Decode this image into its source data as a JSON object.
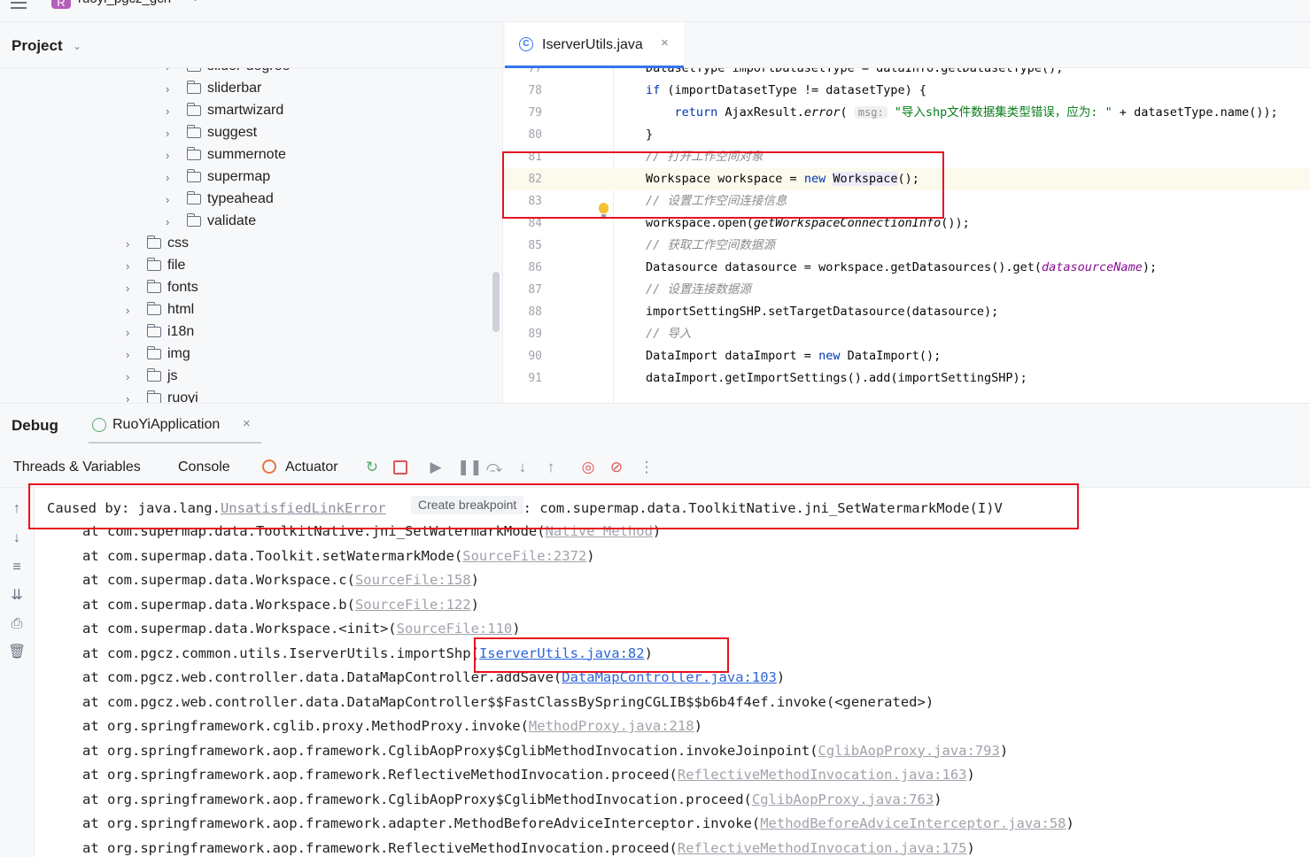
{
  "topbar": {
    "project_badge": "R",
    "project_name": "ruoyi_pgcz_gcn"
  },
  "project_pane": {
    "title": "Project",
    "tree": [
      {
        "label": "slider-degree",
        "indent": 2
      },
      {
        "label": "sliderbar",
        "indent": 2
      },
      {
        "label": "smartwizard",
        "indent": 2
      },
      {
        "label": "suggest",
        "indent": 2
      },
      {
        "label": "summernote",
        "indent": 2
      },
      {
        "label": "supermap",
        "indent": 2
      },
      {
        "label": "typeahead",
        "indent": 2
      },
      {
        "label": "validate",
        "indent": 2
      },
      {
        "label": "css",
        "indent": 1
      },
      {
        "label": "file",
        "indent": 1
      },
      {
        "label": "fonts",
        "indent": 1
      },
      {
        "label": "html",
        "indent": 1
      },
      {
        "label": "i18n",
        "indent": 1
      },
      {
        "label": "img",
        "indent": 1
      },
      {
        "label": "js",
        "indent": 1
      },
      {
        "label": "ruoyi",
        "indent": 1
      }
    ]
  },
  "editor": {
    "tab_title": "IserverUtils.java",
    "tab_icon_letter": "C",
    "current_line": "82",
    "lines": [
      {
        "no": "77",
        "parts": [
          [
            "",
            "DatasetType importDatasetType = dataInfo.getDatasetType();"
          ]
        ]
      },
      {
        "no": "78",
        "parts": [
          [
            "kw",
            "if"
          ],
          [
            "",
            " (importDatasetType != datasetType) {"
          ]
        ]
      },
      {
        "no": "79",
        "parts": [
          [
            "",
            "    "
          ],
          [
            "kw",
            "return"
          ],
          [
            "",
            " AjaxResult."
          ],
          [
            "it",
            "error"
          ],
          [
            "",
            "( "
          ],
          [
            "hint",
            "msg:"
          ],
          [
            "",
            " "
          ],
          [
            "st",
            "\"导入shp文件数据集类型错误，应为: \""
          ],
          [
            "",
            " + datasetType.name());"
          ]
        ]
      },
      {
        "no": "80",
        "parts": [
          [
            "",
            "}"
          ]
        ]
      },
      {
        "no": "81",
        "parts": [
          [
            "cm",
            "// 打开工作空间对象"
          ]
        ]
      },
      {
        "no": "82",
        "parts": [
          [
            "",
            "Workspace workspace = "
          ],
          [
            "kw",
            "new"
          ],
          [
            "",
            " "
          ],
          [
            "hl",
            "Workspace"
          ],
          [
            "",
            "();"
          ]
        ]
      },
      {
        "no": "83",
        "parts": [
          [
            "cm",
            "// 设置工作空间连接信息"
          ]
        ]
      },
      {
        "no": "84",
        "parts": [
          [
            "",
            "workspace.open("
          ],
          [
            "it",
            "getWorkspaceConnectionInfo"
          ],
          [
            "",
            "());"
          ]
        ]
      },
      {
        "no": "85",
        "parts": [
          [
            "cm",
            "// 获取工作空间数据源"
          ]
        ]
      },
      {
        "no": "86",
        "parts": [
          [
            "",
            "Datasource datasource = workspace.getDatasources().get("
          ],
          [
            "fld",
            "datasourceName"
          ],
          [
            "",
            ");"
          ]
        ]
      },
      {
        "no": "87",
        "parts": [
          [
            "cm",
            "// 设置连接数据源"
          ]
        ]
      },
      {
        "no": "88",
        "parts": [
          [
            "",
            "importSettingSHP.setTargetDatasource(datasource);"
          ]
        ]
      },
      {
        "no": "89",
        "parts": [
          [
            "cm",
            "// 导入"
          ]
        ]
      },
      {
        "no": "90",
        "parts": [
          [
            "",
            "DataImport dataImport = "
          ],
          [
            "kw",
            "new"
          ],
          [
            "",
            " DataImport();"
          ]
        ]
      },
      {
        "no": "91",
        "parts": [
          [
            "",
            "dataImport.getImportSettings().add(importSettingSHP);"
          ]
        ]
      }
    ]
  },
  "debug": {
    "title": "Debug",
    "run_config": "RuoYiApplication",
    "tabs": [
      "Threads & Variables",
      "Console",
      "Actuator"
    ]
  },
  "console": {
    "caused_by": {
      "prefix": "Caused by: java.lang.",
      "exception": "UnsatisfiedLinkError",
      "tooltip": "Create breakpoint",
      "suffix": ": com.supermap.data.ToolkitNative.jni_SetWatermarkMode(I)V"
    },
    "frames": [
      {
        "text": "at com.supermap.data.ToolkitNative.jni_SetWatermarkMode(",
        "link": "Native Method",
        "end": ")",
        "active": false
      },
      {
        "text": "at com.supermap.data.Toolkit.setWatermarkMode(",
        "link": "SourceFile:2372",
        "end": ")",
        "active": false
      },
      {
        "text": "at com.supermap.data.Workspace.c(",
        "link": "SourceFile:158",
        "end": ")",
        "active": false
      },
      {
        "text": "at com.supermap.data.Workspace.b(",
        "link": "SourceFile:122",
        "end": ")",
        "active": false
      },
      {
        "text": "at com.supermap.data.Workspace.<init>(",
        "link": "SourceFile:110",
        "end": ")",
        "active": false
      },
      {
        "text": "at com.pgcz.common.utils.IserverUtils.importShp(",
        "link": "IserverUtils.java:82",
        "end": ")",
        "active": true
      },
      {
        "text": "at com.pgcz.web.controller.data.DataMapController.addSave(",
        "link": "DataMapController.java:103",
        "end": ")",
        "active": true
      },
      {
        "text": "at com.pgcz.web.controller.data.DataMapController$$FastClassBySpringCGLIB$$b6b4f4ef.invoke(<generated>)",
        "link": "",
        "end": "",
        "active": false
      },
      {
        "text": "at org.springframework.cglib.proxy.MethodProxy.invoke(",
        "link": "MethodProxy.java:218",
        "end": ")",
        "active": false
      },
      {
        "text": "at org.springframework.aop.framework.CglibAopProxy$CglibMethodInvocation.invokeJoinpoint(",
        "link": "CglibAopProxy.java:793",
        "end": ")",
        "active": false
      },
      {
        "text": "at org.springframework.aop.framework.ReflectiveMethodInvocation.proceed(",
        "link": "ReflectiveMethodInvocation.java:163",
        "end": ")",
        "active": false
      },
      {
        "text": "at org.springframework.aop.framework.CglibAopProxy$CglibMethodInvocation.proceed(",
        "link": "CglibAopProxy.java:763",
        "end": ")",
        "active": false
      },
      {
        "text": "at org.springframework.aop.framework.adapter.MethodBeforeAdviceInterceptor.invoke(",
        "link": "MethodBeforeAdviceInterceptor.java:58",
        "end": ")",
        "active": false
      },
      {
        "text": "at org.springframework.aop.framework.ReflectiveMethodInvocation.proceed(",
        "link": "ReflectiveMethodInvocation.java:175",
        "end": ")",
        "active": false
      }
    ]
  },
  "colors": {
    "accent": "#3574f0",
    "annotation_red": "#e8121f",
    "keyword": "#0033b3",
    "comment": "#8c8c8c",
    "string": "#067d17"
  }
}
